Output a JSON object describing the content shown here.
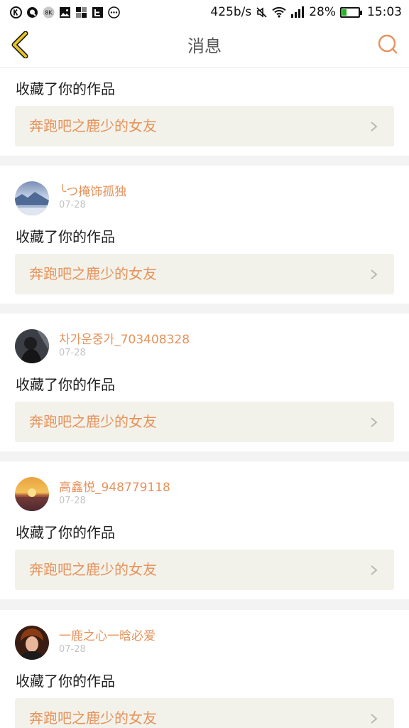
{
  "status_bar": {
    "network_speed": "425b/s",
    "battery": "28%",
    "battery_level": 0.28,
    "time": "15:03",
    "icons": [
      "k-icon",
      "q-icon",
      "app-icon",
      "image-icon",
      "grid-icon",
      "e-icon",
      "more-icon",
      "mute-icon",
      "wifi-icon",
      "signal-icon",
      "battery-icon"
    ]
  },
  "header": {
    "title": "消息",
    "back_icon": "chevron-left-icon",
    "search_icon": "search-icon"
  },
  "colors": {
    "accent": "#e6925b",
    "back_icon": "#e7c420",
    "work_box_bg": "#f3f2ea"
  },
  "feed": {
    "first": {
      "action": "收藏了你的作品",
      "work_title": "奔跑吧之鹿少的女友"
    },
    "items": [
      {
        "username": "╰つ掩饰孤独",
        "date": "07-28",
        "action": "收藏了你的作品",
        "work_title": "奔跑吧之鹿少的女友",
        "avatar": "winter-scene"
      },
      {
        "username": "차가운중가_703408328",
        "date": "07-28",
        "action": "收藏了你的作品",
        "work_title": "奔跑吧之鹿少的女友",
        "avatar": "dark-portrait"
      },
      {
        "username": "高鑫悦_948779118",
        "date": "07-28",
        "action": "收藏了你的作品",
        "work_title": "奔跑吧之鹿少的女友",
        "avatar": "sunset"
      },
      {
        "username": "一鹿之心一晗必爱",
        "date": "07-28",
        "action": "收藏了你的作品",
        "work_title": "奔跑吧之鹿少的女友",
        "avatar": "person"
      }
    ]
  }
}
